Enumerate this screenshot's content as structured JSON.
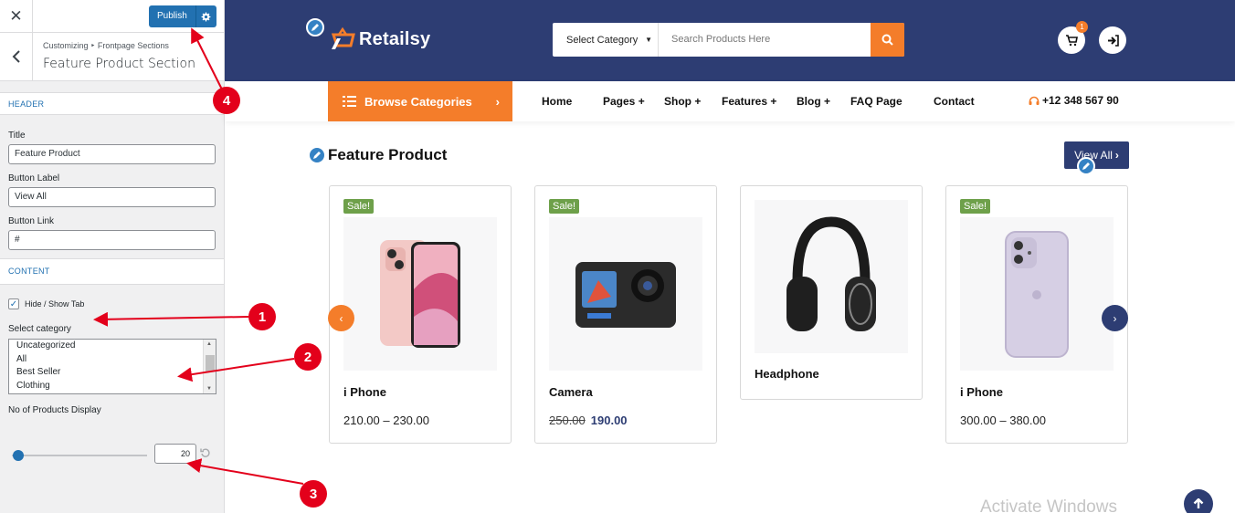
{
  "customizer": {
    "close_icon": "close-icon",
    "publish_label": "Publish",
    "breadcrumb": "Customizing ‣ Frontpage Sections",
    "section_title": "Feature Product Section",
    "header_group": "HEADER",
    "title_label": "Title",
    "title_value": "Feature Product",
    "button_label_label": "Button Label",
    "button_label_value": "View All",
    "button_link_label": "Button Link",
    "button_link_value": "#",
    "content_group": "CONTENT",
    "hide_show_label": "Hide / Show Tab",
    "hide_show_checked": true,
    "select_category_label": "Select category",
    "categories": [
      "Uncategorized",
      "All",
      "Best Seller",
      "Clothing"
    ],
    "products_display_label": "No of Products Display",
    "products_display_value": "20"
  },
  "site": {
    "brand": "Retailsy",
    "category_select": "Select Category",
    "search_placeholder": "Search Products Here",
    "cart_count": "1",
    "browse_label": "Browse Categories",
    "nav": [
      "Home",
      "Pages +",
      "Shop +",
      "Features +",
      "Blog +",
      "FAQ Page",
      "Contact"
    ],
    "phone": "+12 348 567 90",
    "section_title": "Feature Product",
    "view_all": "View All",
    "products": [
      {
        "name": "i Phone",
        "sale": "Sale!",
        "price": "210.00 – 230.00"
      },
      {
        "name": "Camera",
        "sale": "Sale!",
        "old_price": "250.00",
        "new_price": "190.00"
      },
      {
        "name": "Headphone"
      },
      {
        "name": "i Phone",
        "sale": "Sale!",
        "price": "300.00 – 380.00"
      }
    ],
    "watermark": "Activate Windows"
  },
  "annotations": [
    "1",
    "2",
    "3",
    "4"
  ],
  "colors": {
    "header_bg": "#2d3d73",
    "accent_orange": "#f47d2a",
    "wp_blue": "#2271b1",
    "sale_green": "#6ea04a",
    "annotation_red": "#e3001b"
  }
}
